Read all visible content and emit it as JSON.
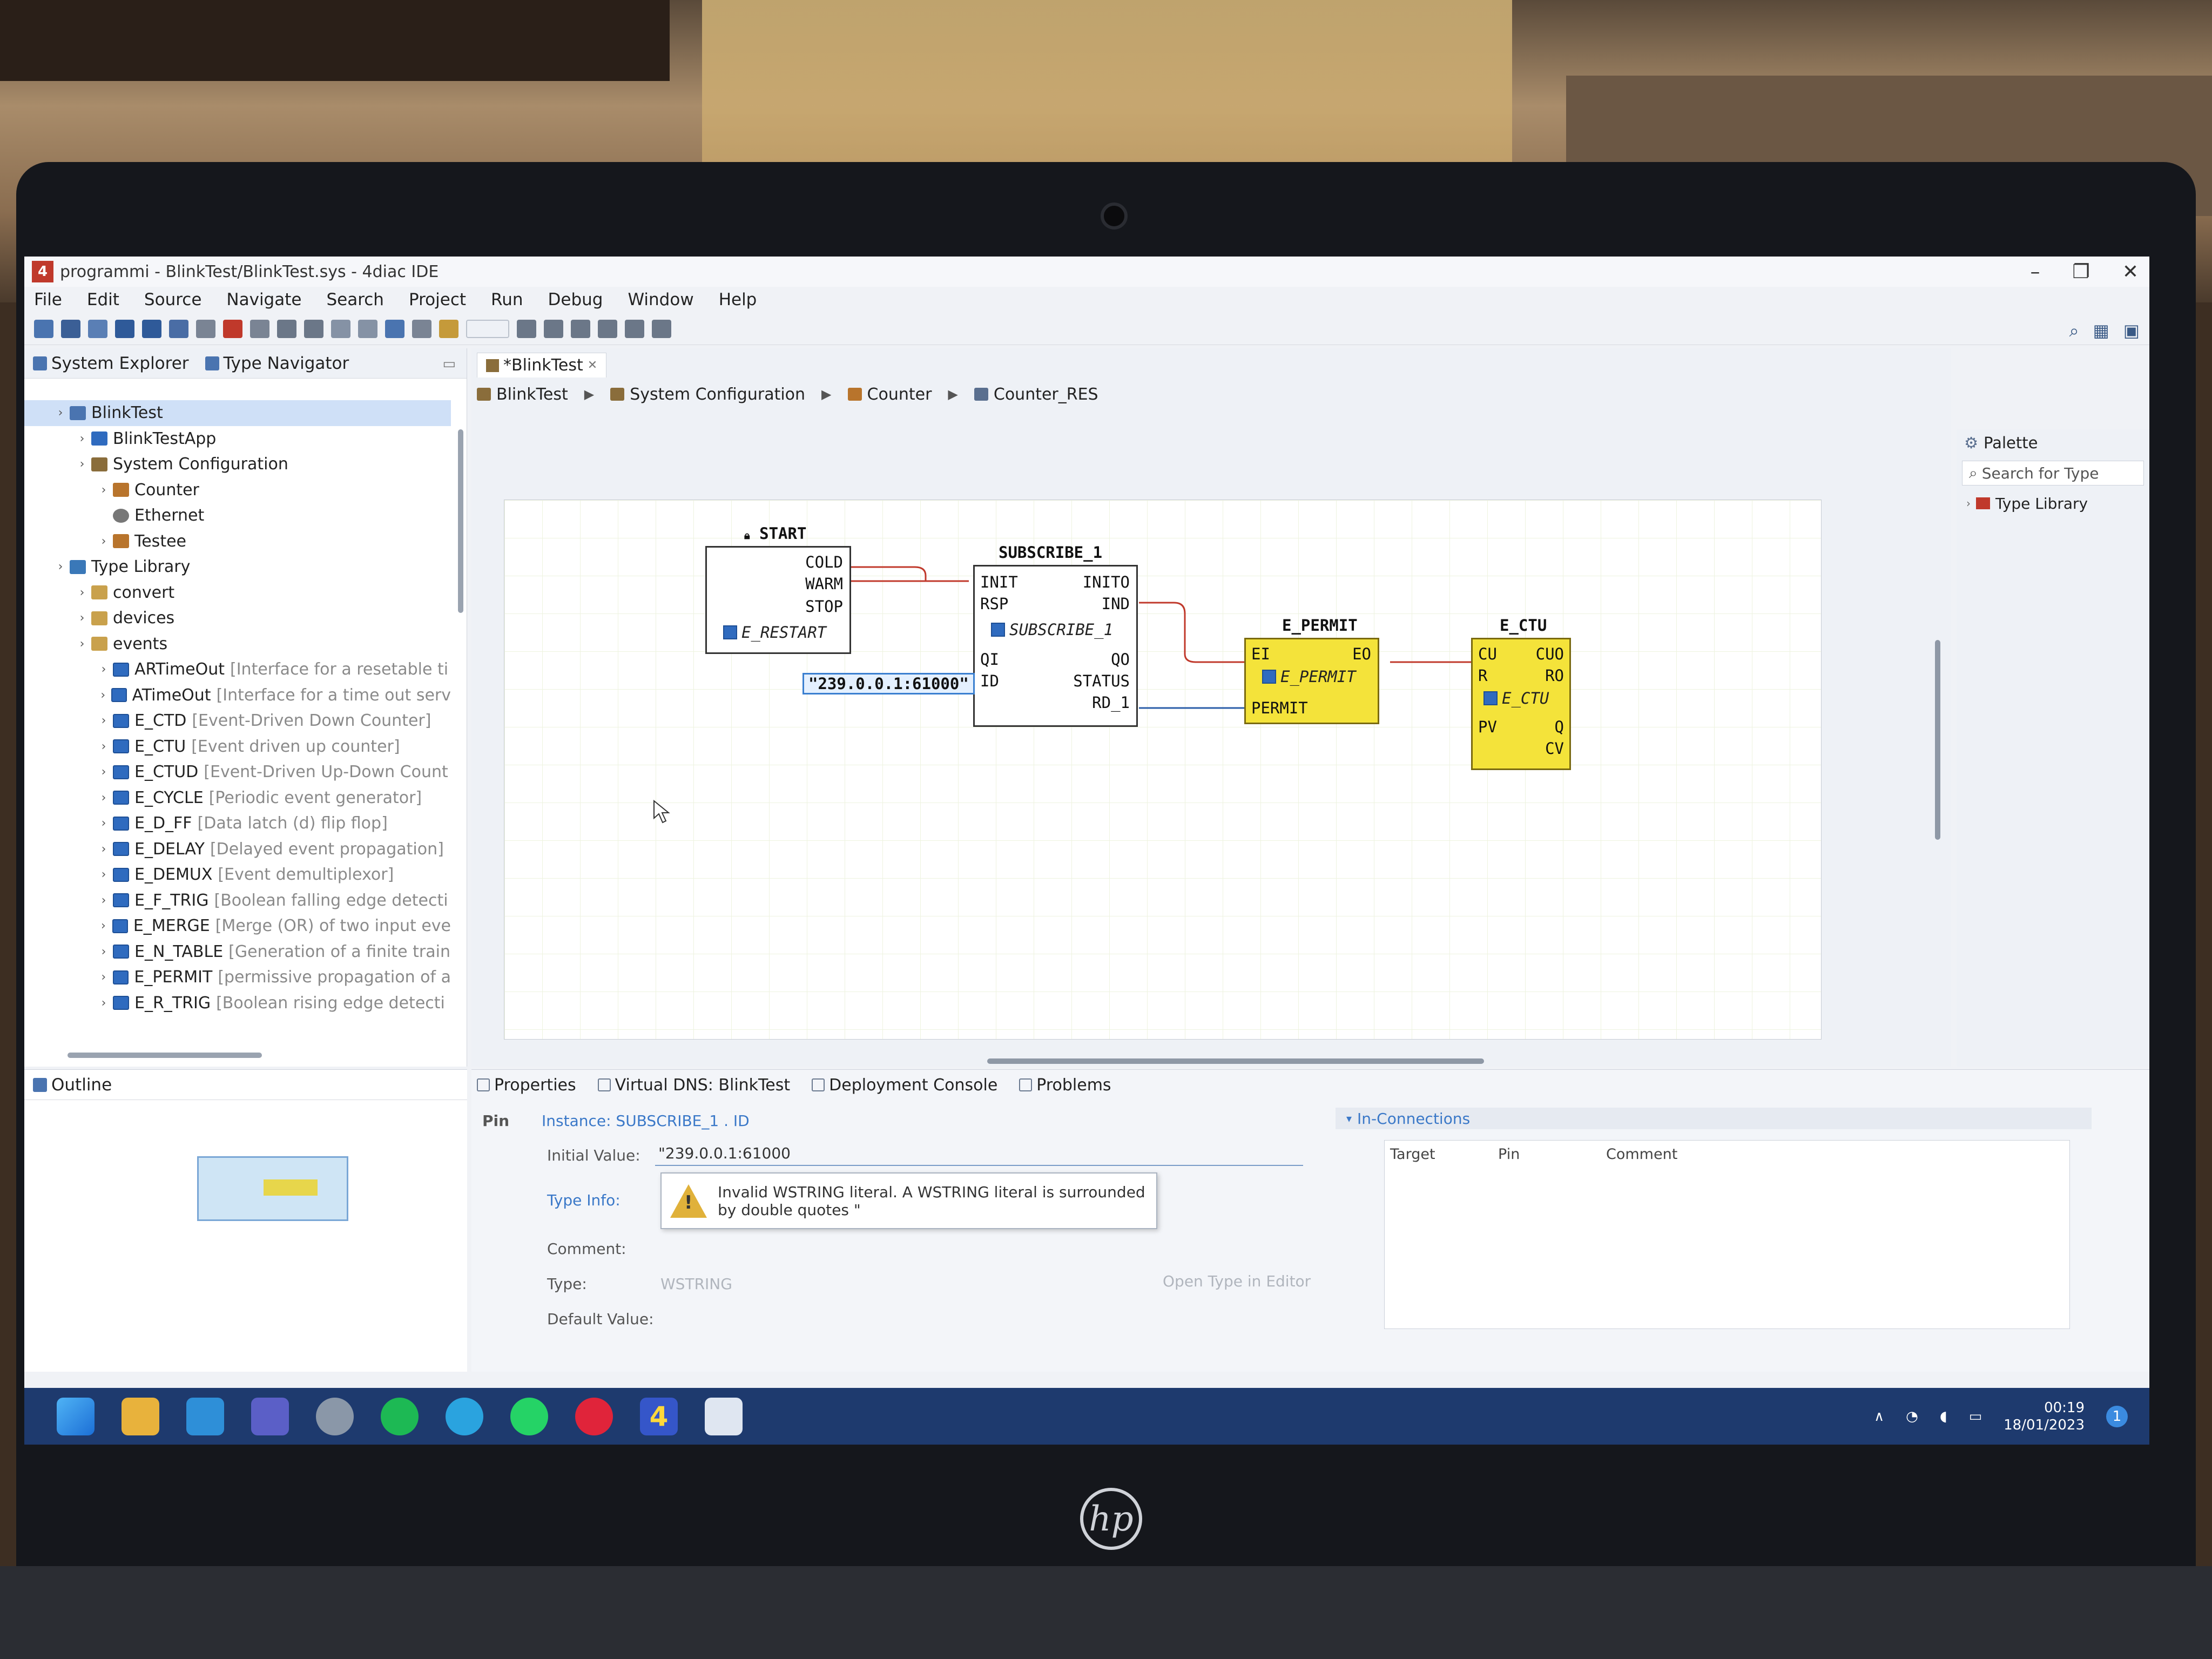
{
  "window": {
    "title": "programmi - BlinkTest/BlinkTest.sys - 4diac IDE",
    "app_icon": "4diac-icon",
    "controls": [
      "–",
      "❐",
      "✕"
    ]
  },
  "menu": [
    "File",
    "Edit",
    "Source",
    "Navigate",
    "Search",
    "Project",
    "Run",
    "Debug",
    "Window",
    "Help"
  ],
  "left_panel": {
    "tabs": [
      "System Explorer",
      "Type Navigator"
    ],
    "tree": [
      {
        "label": "BlinkTest",
        "level": 0,
        "icon": "system-icon",
        "selected": true
      },
      {
        "label": "BlinkTestApp",
        "level": 1,
        "icon": "application-icon"
      },
      {
        "label": "System Configuration",
        "level": 1,
        "icon": "system-configuration-icon"
      },
      {
        "label": "Counter",
        "level": 2,
        "icon": "device-icon"
      },
      {
        "label": "Ethernet",
        "level": 2,
        "icon": "network-icon"
      },
      {
        "label": "Testee",
        "level": 2,
        "icon": "device-icon"
      },
      {
        "label": "Type Library",
        "level": 0,
        "icon": "library-icon"
      },
      {
        "label": "convert",
        "level": 1,
        "icon": "folder-icon"
      },
      {
        "label": "devices",
        "level": 1,
        "icon": "folder-icon"
      },
      {
        "label": "events",
        "level": 1,
        "icon": "folder-icon"
      },
      {
        "label": "ARTimeOut",
        "desc": "[Interface for a resetable ti",
        "level": 2,
        "icon": "function-block-icon"
      },
      {
        "label": "ATimeOut",
        "desc": "[Interface for a time out serv",
        "level": 2,
        "icon": "function-block-icon"
      },
      {
        "label": "E_CTD",
        "desc": "[Event-Driven Down Counter]",
        "level": 2,
        "icon": "function-block-icon"
      },
      {
        "label": "E_CTU",
        "desc": "[Event driven up counter]",
        "level": 2,
        "icon": "function-block-icon"
      },
      {
        "label": "E_CTUD",
        "desc": "[Event-Driven Up-Down Count",
        "level": 2,
        "icon": "function-block-icon"
      },
      {
        "label": "E_CYCLE",
        "desc": "[Periodic event generator]",
        "level": 2,
        "icon": "function-block-icon"
      },
      {
        "label": "E_D_FF",
        "desc": "[Data latch (d) flip flop]",
        "level": 2,
        "icon": "function-block-icon"
      },
      {
        "label": "E_DELAY",
        "desc": "[Delayed event propagation]",
        "level": 2,
        "icon": "function-block-icon"
      },
      {
        "label": "E_DEMUX",
        "desc": "[Event demultiplexor]",
        "level": 2,
        "icon": "function-block-icon"
      },
      {
        "label": "E_F_TRIG",
        "desc": "[Boolean falling edge detecti",
        "level": 2,
        "icon": "function-block-icon"
      },
      {
        "label": "E_MERGE",
        "desc": "[Merge (OR) of two input eve",
        "level": 2,
        "icon": "function-block-icon"
      },
      {
        "label": "E_N_TABLE",
        "desc": "[Generation of a finite train",
        "level": 2,
        "icon": "function-block-icon"
      },
      {
        "label": "E_PERMIT",
        "desc": "[permissive propagation of a",
        "level": 2,
        "icon": "function-block-icon"
      },
      {
        "label": "E_R_TRIG",
        "desc": "[Boolean rising edge detecti",
        "level": 2,
        "icon": "function-block-icon"
      }
    ]
  },
  "outline": {
    "tab": "Outline"
  },
  "editor": {
    "tab": "*BlinkTest",
    "breadcrumb": [
      "BlinkTest",
      "System Configuration",
      "Counter",
      "Counter_RES"
    ],
    "blocks": {
      "start": {
        "name": "START",
        "type": "E_RESTART",
        "outputs": [
          "COLD",
          "WARM",
          "STOP"
        ]
      },
      "subscribe": {
        "name": "SUBSCRIBE_1",
        "type": "SUBSCRIBE_1",
        "event_in": [
          "INIT",
          "RSP"
        ],
        "event_out": [
          "INITO",
          "IND"
        ],
        "data_in": [
          "QI",
          "ID"
        ],
        "data_out": [
          "QO",
          "STATUS",
          "RD_1"
        ],
        "id_value": "\"239.0.0.1:61000\""
      },
      "permit": {
        "name": "E_PERMIT",
        "type": "E_PERMIT",
        "event_in": [
          "EI"
        ],
        "event_out": [
          "EO"
        ],
        "data_in": [
          "PERMIT"
        ]
      },
      "ctu": {
        "name": "E_CTU",
        "type": "E_CTU",
        "event_in": [
          "CU",
          "R"
        ],
        "event_out": [
          "CUO",
          "RO"
        ],
        "data_in": [
          "PV"
        ],
        "data_out": [
          "Q",
          "CV"
        ]
      }
    }
  },
  "palette": {
    "title": "Palette",
    "search_placeholder": "Search for Type",
    "items": [
      "Type Library"
    ]
  },
  "bottom": {
    "tabs": [
      "Properties",
      "Virtual DNS: BlinkTest",
      "Deployment Console",
      "Problems"
    ],
    "pin_label": "Pin",
    "instance_header": "Instance: SUBSCRIBE_1 . ID",
    "initial_value_label": "Initial Value:",
    "initial_value": "\"239.0.0.1:61000",
    "warning": "Invalid WSTRING literal. A WSTRING literal is surrounded by double quotes \"",
    "type_info_label": "Type Info:",
    "comment_label": "Comment:",
    "type_label": "Type:",
    "type_value": "WSTRING",
    "open_type_link": "Open Type in Editor",
    "default_value_label": "Default Value:",
    "in_connections": "In-Connections",
    "columns": [
      "Target",
      "Pin",
      "Comment"
    ]
  },
  "taskbar": {
    "apps": [
      "windows-start-icon",
      "file-explorer-icon",
      "mail-icon",
      "teams-icon",
      "chrome-icon",
      "spotify-icon",
      "telegram-icon",
      "whatsapp-icon",
      "opera-icon",
      "4diac-icon",
      "notes-icon"
    ],
    "time": "00:19",
    "date": "18/01/2023",
    "notification_count": "1"
  },
  "colors": {
    "fb_yellow": "#f4e33a",
    "event_connection": "#c0392b",
    "data_connection": "#2a5da8",
    "taskbar": "#1e3a6e"
  }
}
